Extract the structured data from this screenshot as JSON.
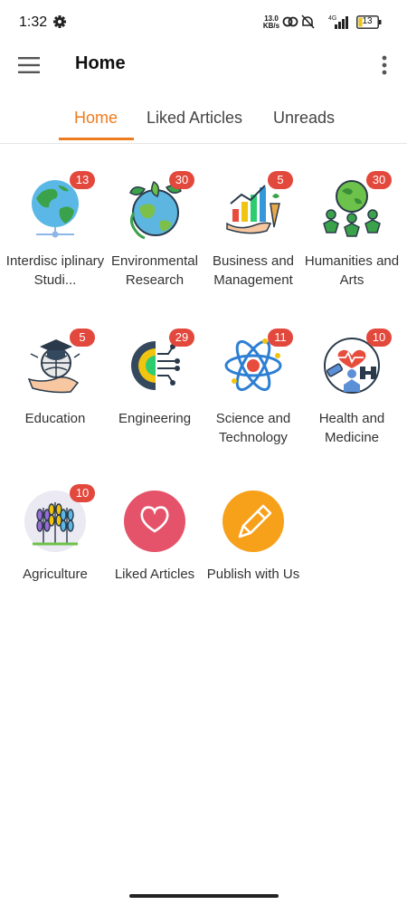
{
  "status_bar": {
    "time": "1:32",
    "net_speed_top": "13.0",
    "net_speed_bottom": "KB/s",
    "network": "4G",
    "battery": "13"
  },
  "app_bar": {
    "title": "Home",
    "menu_icon": "hamburger-menu-icon",
    "overflow_icon": "more-vert-icon"
  },
  "tabs": [
    {
      "label": "Home",
      "active": true
    },
    {
      "label": "Liked Articles",
      "active": false
    },
    {
      "label": "Unreads",
      "active": false
    }
  ],
  "categories": [
    {
      "label": "Interdisc iplinary Studi...",
      "badge": "13",
      "icon": "globe-network-icon"
    },
    {
      "label": "Environmental Research",
      "badge": "30",
      "icon": "eco-globe-icon"
    },
    {
      "label": "Business and Management",
      "badge": "5",
      "icon": "growth-chart-icon"
    },
    {
      "label": "Humanities and Arts",
      "badge": "30",
      "icon": "people-globe-icon"
    },
    {
      "label": "Education",
      "badge": "5",
      "icon": "graduation-globe-icon"
    },
    {
      "label": "Engineering",
      "badge": "29",
      "icon": "gear-circuit-icon"
    },
    {
      "label": "Science and Technology",
      "badge": "11",
      "icon": "atom-icon"
    },
    {
      "label": "Health and Medicine",
      "badge": "10",
      "icon": "health-fitness-icon"
    },
    {
      "label": "Agriculture",
      "badge": "10",
      "icon": "wheat-icon"
    },
    {
      "label": "Liked Articles",
      "badge": null,
      "icon": "heart-icon"
    },
    {
      "label": "Publish with Us",
      "badge": null,
      "icon": "pencil-icon"
    }
  ],
  "colors": {
    "accent": "#ee7b1e",
    "badge": "#e2483c",
    "liked_circle": "#e5536a",
    "publish_circle": "#f7a11a"
  }
}
